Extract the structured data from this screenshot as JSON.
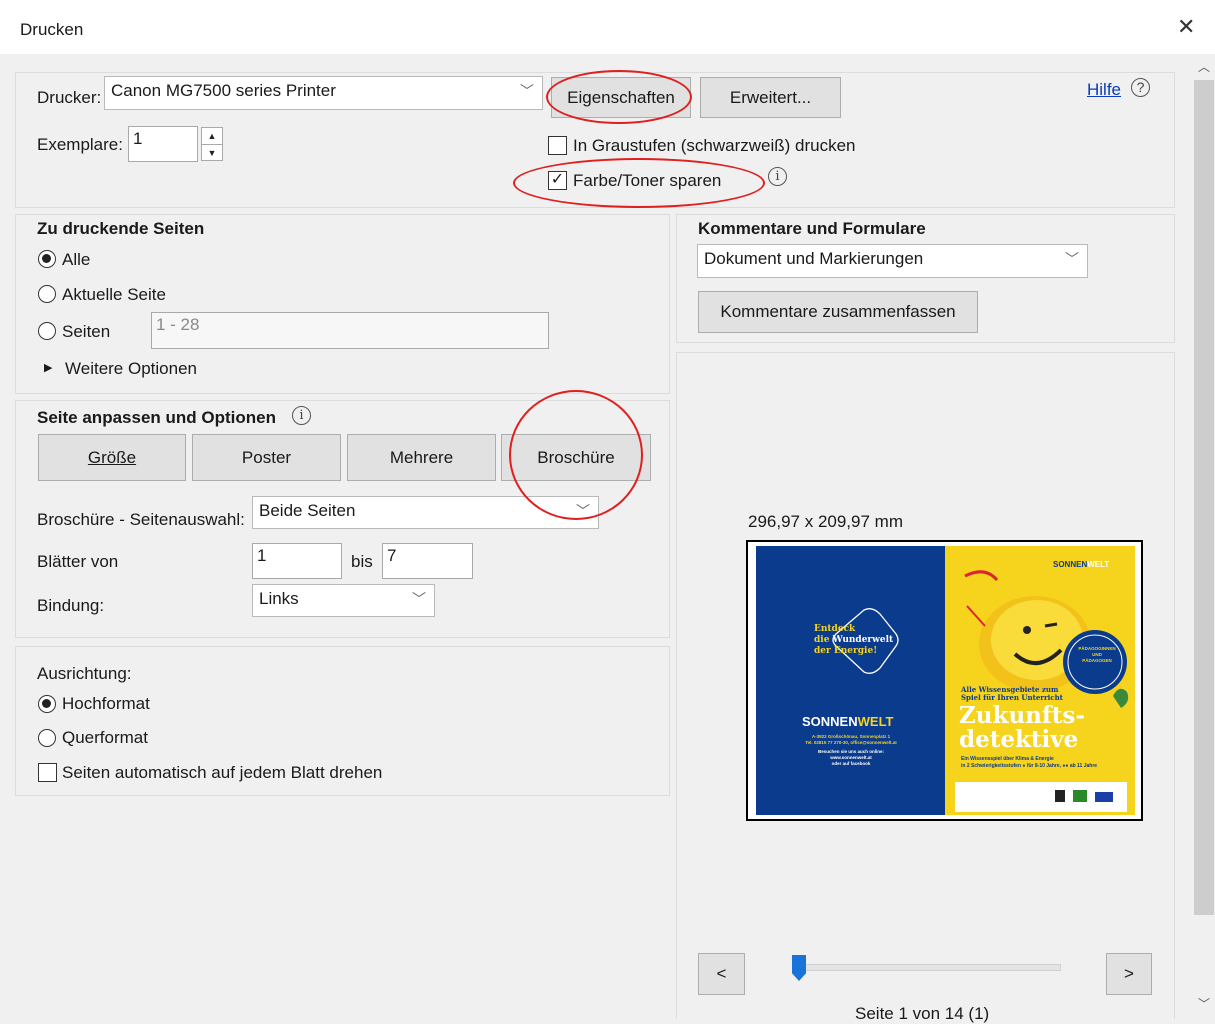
{
  "window": {
    "title": "Drucken"
  },
  "printer": {
    "label": "Drucker:",
    "selected": "Canon MG7500 series Printer",
    "properties_button": "Eigenschaften",
    "advanced_button": "Erweitert...",
    "help_link": "Hilfe",
    "copies_label": "Exemplare:",
    "copies_value": "1",
    "grayscale_label": "In Graustufen (schwarzweiß) drucken",
    "grayscale_checked": false,
    "save_ink_label": "Farbe/Toner sparen",
    "save_ink_checked": true
  },
  "pages": {
    "heading": "Zu druckende Seiten",
    "all_label": "Alle",
    "current_label": "Aktuelle Seite",
    "range_label": "Seiten",
    "range_value": "1 - 28",
    "more_options": "Weitere Optionen",
    "selected": "Alle"
  },
  "comments": {
    "heading": "Kommentare und Formulare",
    "selected": "Dokument und Markierungen",
    "summarize_button": "Kommentare zusammenfassen"
  },
  "fit": {
    "heading": "Seite anpassen und Optionen",
    "size_button": "Größe",
    "poster_button": "Poster",
    "multiple_button": "Mehrere",
    "booklet_button": "Broschüre",
    "booklet_subset_label": "Broschüre - Seitenauswahl:",
    "booklet_subset_value": "Beide Seiten",
    "sheets_label": "Blätter von",
    "sheets_from": "1",
    "sheets_to_label": "bis",
    "sheets_to": "7",
    "binding_label": "Bindung:",
    "binding_value": "Links"
  },
  "orientation": {
    "label": "Ausrichtung:",
    "portrait_label": "Hochformat",
    "landscape_label": "Querformat",
    "auto_rotate_label": "Seiten automatisch auf jedem Blatt drehen",
    "selected": "Hochformat",
    "auto_rotate_checked": false
  },
  "preview": {
    "size": "296,97 x 209,97 mm",
    "prev_button": "<",
    "next_button": ">",
    "page_indicator": "Seite 1 von 14 (1)",
    "slider_fraction": 0.0,
    "left_page": {
      "slogan_line1": "Entdeck",
      "slogan_line2": "die Wunderwelt",
      "slogan_line3": "der Energie!",
      "logo_sonnen": "SONNEN",
      "logo_welt": "WELT",
      "address_line1": "A-3922 Großschönau, Sonnenplatz 1",
      "address_line2": "Tel. 02815 77 270-30, office@sonnenwelt.at",
      "visit_line1": "Besuchen sie uns auch online:",
      "visit_line2": "www.sonnenwelt.at",
      "visit_line3": "oder auf facebook"
    },
    "right_page": {
      "logo_sonnen": "SONNEN",
      "logo_welt": "WELT",
      "subtitle_line1": "Alle Wissensgebiete zum",
      "subtitle_line2": "Spiel für Ihren Unterricht",
      "title_line1": "Zukunfts-",
      "title_line2": "detektive",
      "desc_line1": "Ein Wissensspiel über Klima & Energie",
      "desc_line2": "in 2 Schwierigkeitsstufen ● für 8-10 Jahre, ●● ab 11 Jahre",
      "badge_line1": "PÄDAGOGINNEN",
      "badge_line2": "UND PÄDAGOGEN",
      "colors": {
        "yellow": "#f6d31c",
        "blue": "#0b3b8c"
      }
    }
  },
  "colors": {
    "accent_blue": "#0a3bbd",
    "annotation_red": "#e02020"
  }
}
